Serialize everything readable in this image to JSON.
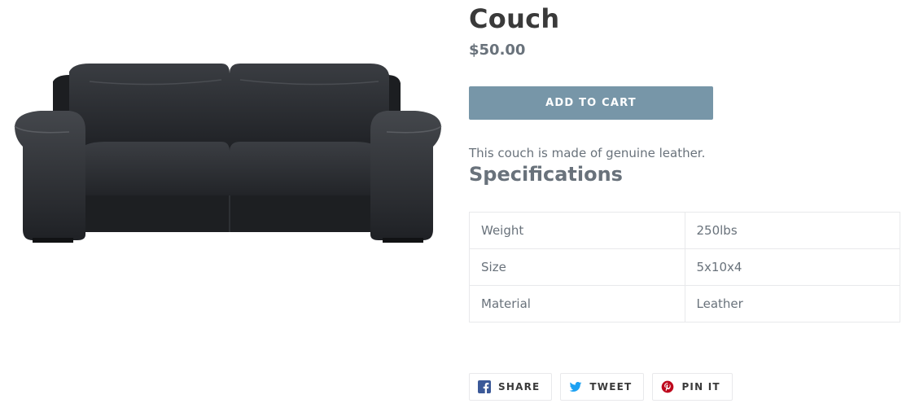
{
  "product": {
    "title": "Couch",
    "price": "$50.00",
    "add_to_cart_label": "ADD TO CART",
    "description": "This couch is made of genuine leather.",
    "image_icon": "leather-couch-image"
  },
  "specifications": {
    "heading": "Specifications",
    "rows": [
      {
        "label": "Weight",
        "value": "250lbs"
      },
      {
        "label": "Size",
        "value": "5x10x4"
      },
      {
        "label": "Material",
        "value": "Leather"
      }
    ]
  },
  "social": {
    "share_label": "SHARE",
    "tweet_label": "TWEET",
    "pin_label": "PIN IT"
  },
  "colors": {
    "button_bg": "#7796a8",
    "facebook": "#3b5998",
    "twitter": "#1da1f2",
    "pinterest": "#bd081c",
    "text_muted": "#69727b"
  }
}
